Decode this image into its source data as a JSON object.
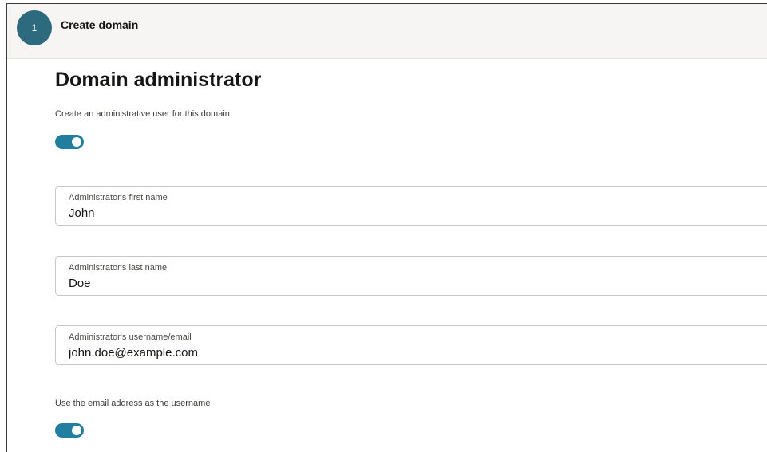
{
  "header": {
    "step_number": "1",
    "step_label": "Create domain"
  },
  "section": {
    "title": "Domain administrator",
    "create_admin_label": "Create an administrative user for this domain",
    "create_admin_enabled": true
  },
  "fields": {
    "first_name": {
      "label": "Administrator's first name",
      "value": "John"
    },
    "last_name": {
      "label": "Administrator's last name",
      "value": "Doe"
    },
    "username": {
      "label": "Administrator's username/email",
      "value": "john.doe@example.com"
    }
  },
  "email_as_username": {
    "label": "Use the email address as the username",
    "enabled": true
  },
  "colors": {
    "accent": "#227e9e",
    "step_circle": "#2d6a7e",
    "header_bg": "#f6f5f3"
  }
}
